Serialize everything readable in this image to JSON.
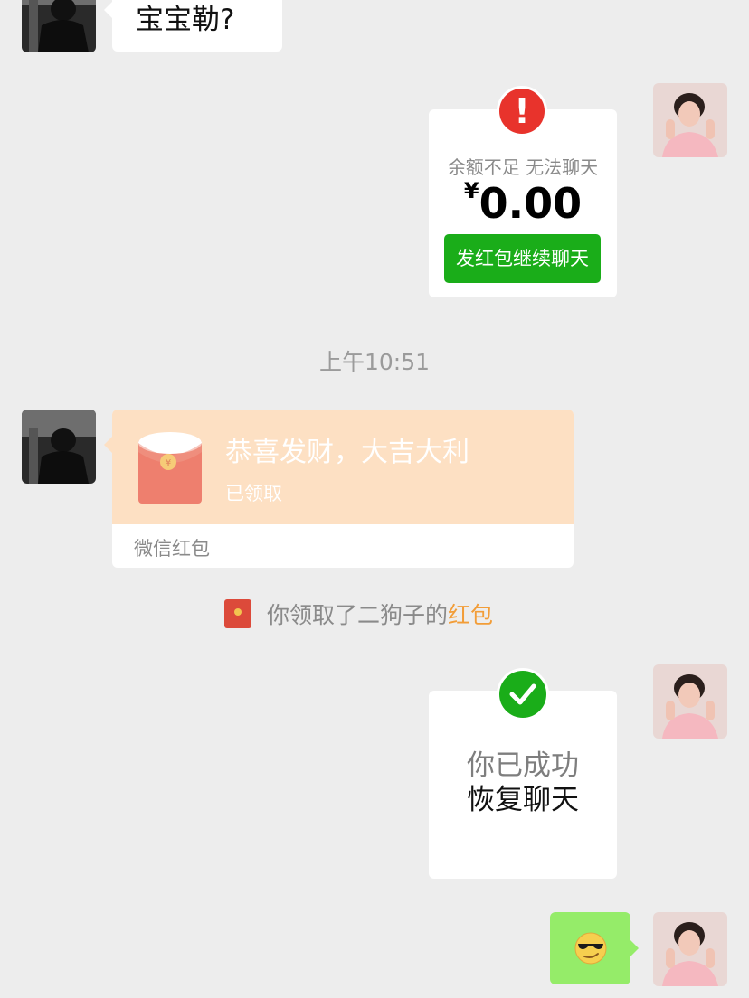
{
  "messages": {
    "incoming_text": "宝宝勒?",
    "balance_card": {
      "caption": "余额不足 无法聊天",
      "currency": "¥",
      "amount": "0.00",
      "button_label": "发红包继续聊天"
    },
    "timestamp": "上午10:51",
    "red_packet": {
      "title": "恭喜发财，大吉大利",
      "status": "已领取",
      "footer": "微信红包"
    },
    "system_notice": {
      "text": "你领取了二狗子的",
      "link": "红包"
    },
    "restored_card": {
      "line1": "你已成功",
      "line2": "恢复聊天"
    },
    "outgoing_emoji": "smirk-sunglasses-emoji"
  },
  "colors": {
    "background": "#ededed",
    "wechat_green": "#1aad19",
    "outgoing_bubble": "#95ec69",
    "red_packet_bg": "#fde0c3",
    "alert_red": "#e8332c",
    "link_orange": "#f29d38"
  },
  "icons": [
    "alert-icon",
    "check-icon",
    "red-packet-icon",
    "envelope-icon",
    "emoji-sunglasses-icon"
  ]
}
